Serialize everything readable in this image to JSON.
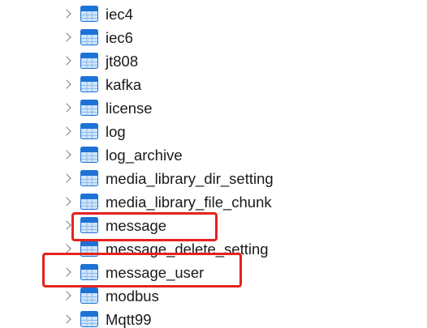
{
  "tree": {
    "items": [
      {
        "label": "iec4",
        "icon": "database-table-icon"
      },
      {
        "label": "iec6",
        "icon": "database-table-icon"
      },
      {
        "label": "jt808",
        "icon": "database-table-icon"
      },
      {
        "label": "kafka",
        "icon": "database-table-icon"
      },
      {
        "label": "license",
        "icon": "database-table-icon"
      },
      {
        "label": "log",
        "icon": "database-table-icon"
      },
      {
        "label": "log_archive",
        "icon": "database-table-icon"
      },
      {
        "label": "media_library_dir_setting",
        "icon": "database-table-icon"
      },
      {
        "label": "media_library_file_chunk",
        "icon": "database-table-icon"
      },
      {
        "label": "message",
        "icon": "database-table-icon"
      },
      {
        "label": "message_delete_setting",
        "icon": "database-table-icon"
      },
      {
        "label": "message_user",
        "icon": "database-table-icon"
      },
      {
        "label": "modbus",
        "icon": "database-table-icon"
      },
      {
        "label": "Mqtt99",
        "icon": "database-table-icon"
      }
    ]
  },
  "colors": {
    "icon_header": "#1d72d6",
    "icon_body": "#cfe5fb",
    "icon_grid": "#8fbbea",
    "annotation": "#e5231f",
    "chevron": "#7a7a7a",
    "text": "#1a1a1a"
  }
}
